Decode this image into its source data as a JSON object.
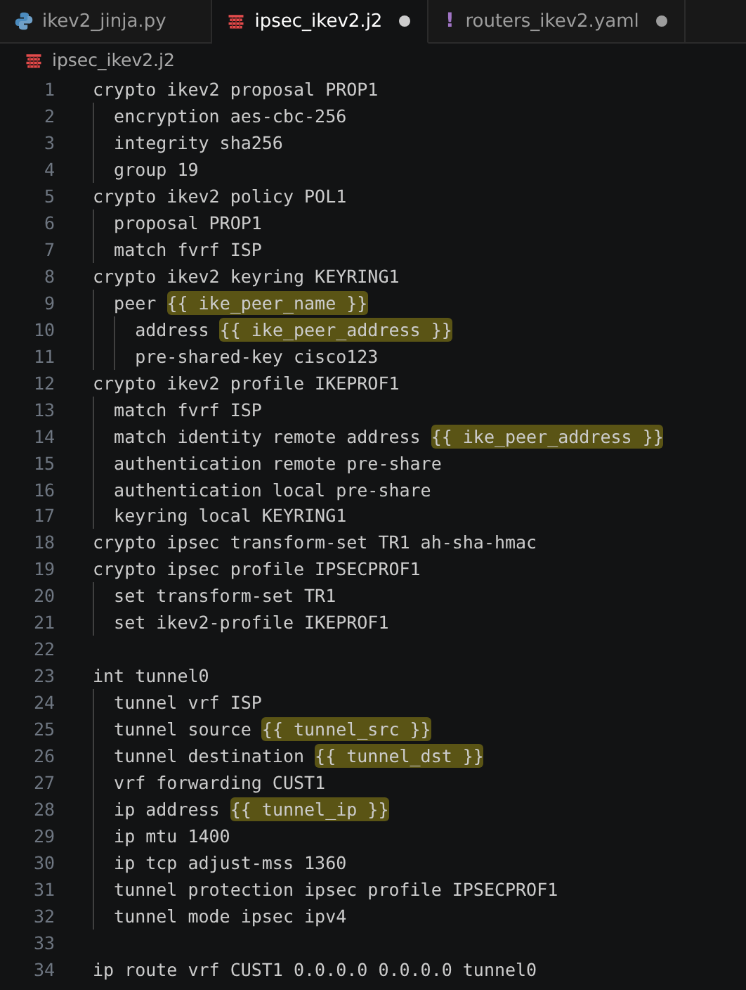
{
  "tabs": [
    {
      "label": "ikev2_jinja.py",
      "kind": "python",
      "selected": false,
      "modified": false
    },
    {
      "label": "ipsec_ikev2.j2",
      "kind": "jinja",
      "selected": true,
      "modified": true
    },
    {
      "label": "routers_ikev2.yaml",
      "kind": "yaml",
      "glyph": "!",
      "selected": false,
      "modified": true
    }
  ],
  "breadcrumb": {
    "label": "ipsec_ikev2.j2",
    "kind": "jinja"
  },
  "lines": [
    {
      "number": "1",
      "segments": [
        {
          "text": "crypto ikev2 proposal PROP1",
          "highlighted": false
        }
      ]
    },
    {
      "number": "2",
      "segments": [
        {
          "text": "  encryption aes-cbc-256",
          "highlighted": false
        }
      ]
    },
    {
      "number": "3",
      "segments": [
        {
          "text": "  integrity sha256",
          "highlighted": false
        }
      ]
    },
    {
      "number": "4",
      "segments": [
        {
          "text": "  group 19",
          "highlighted": false
        }
      ]
    },
    {
      "number": "5",
      "segments": [
        {
          "text": "crypto ikev2 policy POL1",
          "highlighted": false
        }
      ]
    },
    {
      "number": "6",
      "segments": [
        {
          "text": "  proposal PROP1",
          "highlighted": false
        }
      ]
    },
    {
      "number": "7",
      "segments": [
        {
          "text": "  match fvrf ISP",
          "highlighted": false
        }
      ]
    },
    {
      "number": "8",
      "segments": [
        {
          "text": "crypto ikev2 keyring KEYRING1",
          "highlighted": false
        }
      ]
    },
    {
      "number": "9",
      "segments": [
        {
          "text": "  peer ",
          "highlighted": false
        },
        {
          "text": "{{ ike_peer_name }}",
          "highlighted": true
        }
      ]
    },
    {
      "number": "10",
      "segments": [
        {
          "text": "    address ",
          "highlighted": false
        },
        {
          "text": "{{ ike_peer_address }}",
          "highlighted": true
        }
      ]
    },
    {
      "number": "11",
      "segments": [
        {
          "text": "    pre-shared-key cisco123",
          "highlighted": false
        }
      ]
    },
    {
      "number": "12",
      "segments": [
        {
          "text": "crypto ikev2 profile IKEPROF1",
          "highlighted": false
        }
      ]
    },
    {
      "number": "13",
      "segments": [
        {
          "text": "  match fvrf ISP",
          "highlighted": false
        }
      ]
    },
    {
      "number": "14",
      "segments": [
        {
          "text": "  match identity remote address ",
          "highlighted": false
        },
        {
          "text": "{{ ike_peer_address }}",
          "highlighted": true
        }
      ]
    },
    {
      "number": "15",
      "segments": [
        {
          "text": "  authentication remote pre-share",
          "highlighted": false
        }
      ]
    },
    {
      "number": "16",
      "segments": [
        {
          "text": "  authentication local pre-share",
          "highlighted": false
        }
      ]
    },
    {
      "number": "17",
      "segments": [
        {
          "text": "  keyring local KEYRING1",
          "highlighted": false
        }
      ]
    },
    {
      "number": "18",
      "segments": [
        {
          "text": "crypto ipsec transform-set TR1 ah-sha-hmac",
          "highlighted": false
        }
      ]
    },
    {
      "number": "19",
      "segments": [
        {
          "text": "crypto ipsec profile IPSECPROF1",
          "highlighted": false
        }
      ]
    },
    {
      "number": "20",
      "segments": [
        {
          "text": "  set transform-set TR1",
          "highlighted": false
        }
      ]
    },
    {
      "number": "21",
      "segments": [
        {
          "text": "  set ikev2-profile IKEPROF1",
          "highlighted": false
        }
      ]
    },
    {
      "number": "22"
    },
    {
      "number": "23",
      "segments": [
        {
          "text": "int tunnel0",
          "highlighted": false
        }
      ]
    },
    {
      "number": "24",
      "segments": [
        {
          "text": "  tunnel vrf ISP",
          "highlighted": false
        }
      ]
    },
    {
      "number": "25",
      "segments": [
        {
          "text": "  tunnel source ",
          "highlighted": false
        },
        {
          "text": "{{ tunnel_src }}",
          "highlighted": true
        }
      ]
    },
    {
      "number": "26",
      "segments": [
        {
          "text": "  tunnel destination ",
          "highlighted": false
        },
        {
          "text": "{{ tunnel_dst }}",
          "highlighted": true
        }
      ]
    },
    {
      "number": "27",
      "segments": [
        {
          "text": "  vrf forwarding CUST1",
          "highlighted": false
        }
      ]
    },
    {
      "number": "28",
      "segments": [
        {
          "text": "  ip address ",
          "highlighted": false
        },
        {
          "text": "{{ tunnel_ip }}",
          "highlighted": true
        }
      ]
    },
    {
      "number": "29",
      "segments": [
        {
          "text": "  ip mtu 1400",
          "highlighted": false
        }
      ]
    },
    {
      "number": "30",
      "segments": [
        {
          "text": "  ip tcp adjust-mss 1360",
          "highlighted": false
        }
      ]
    },
    {
      "number": "31",
      "segments": [
        {
          "text": "  tunnel protection ipsec profile IPSECPROF1",
          "highlighted": false
        }
      ]
    },
    {
      "number": "32",
      "segments": [
        {
          "text": "  tunnel mode ipsec ipv4",
          "highlighted": false
        }
      ]
    },
    {
      "number": "33"
    },
    {
      "number": "34",
      "segments": [
        {
          "text": "ip route vrf CUST1 0.0.0.0 0.0.0.0 tunnel0",
          "highlighted": false
        }
      ]
    }
  ]
}
